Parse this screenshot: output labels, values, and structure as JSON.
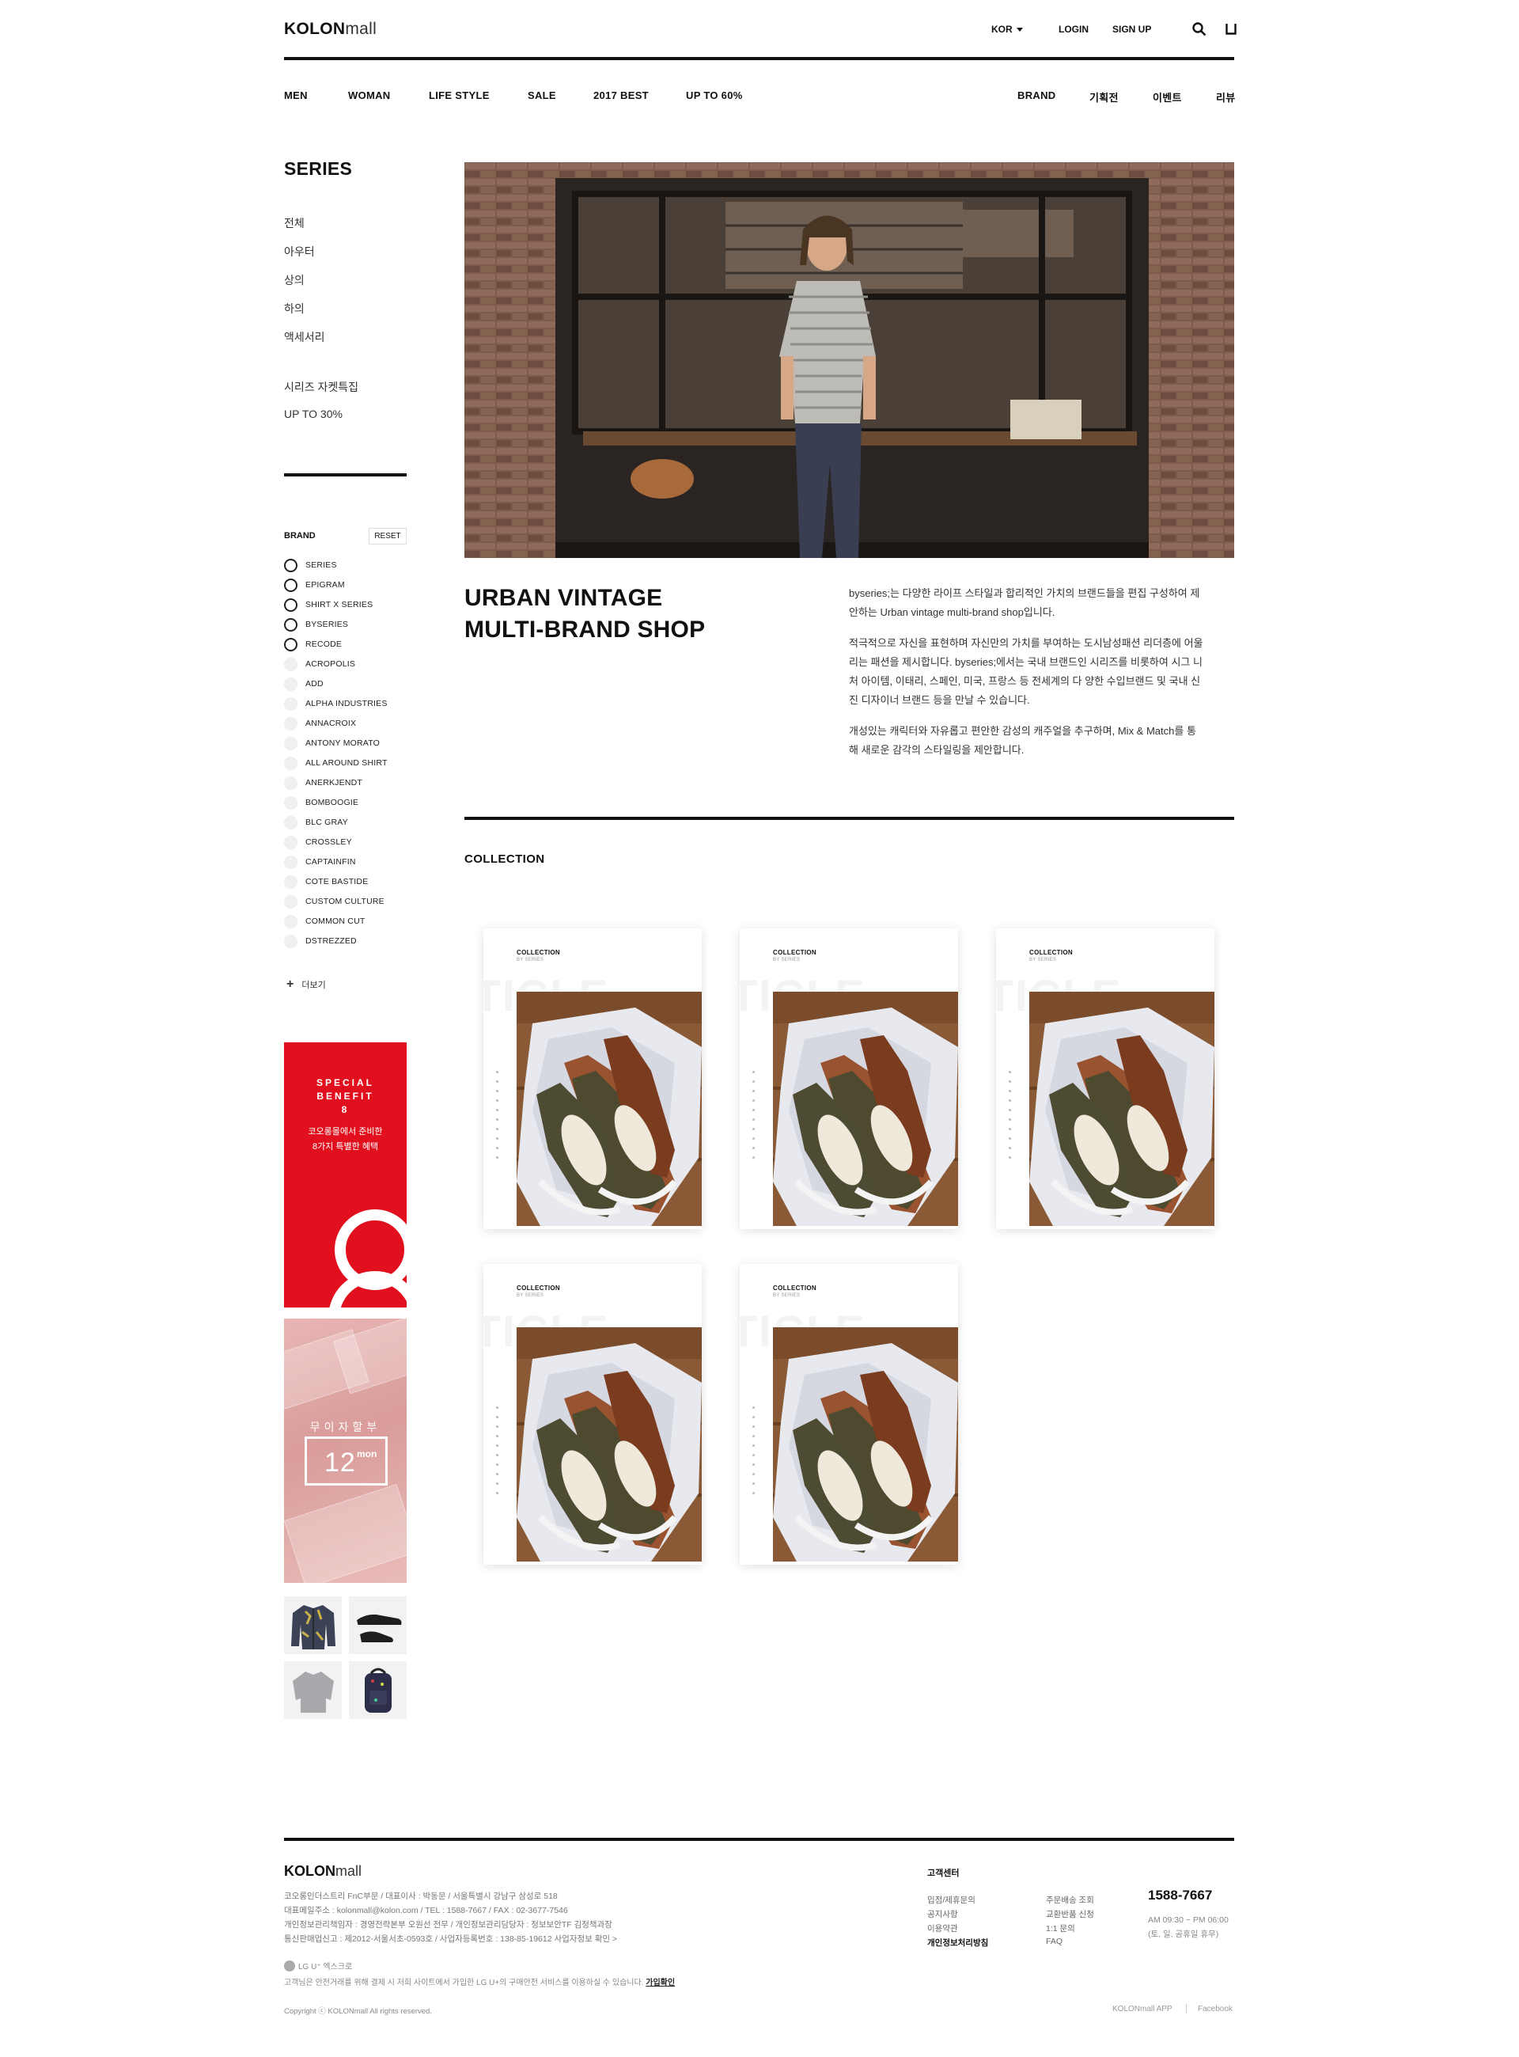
{
  "header": {
    "logo_bold": "KOLON",
    "logo_light": "mall",
    "lang": "KOR",
    "login": "LOGIN",
    "signup": "SIGN UP",
    "icons": [
      "search-icon",
      "bag-icon"
    ]
  },
  "nav": {
    "left": [
      "MEN",
      "WOMAN",
      "LIFE STYLE",
      "SALE",
      "2017 BEST",
      "UP TO 60%"
    ],
    "right": [
      "BRAND",
      "기획전",
      "이벤트",
      "리뷰"
    ]
  },
  "sidebar": {
    "title": "SERIES",
    "categories": [
      "전체",
      "아우터",
      "상의",
      "하의",
      "액세서리"
    ],
    "extras": [
      "시리즈 자켓특집",
      "UP TO 30%"
    ],
    "brand_label": "BRAND",
    "reset": "RESET",
    "brands": [
      "SERIES",
      "EPIGRAM",
      "SHIRT X SERIES",
      "BYSERIES",
      "RECODE",
      "ACROPOLIS",
      "ADD",
      "ALPHA INDUSTRIES",
      "ANNACROIX",
      "ANTONY MORATO",
      "ALL AROUND SHIRT",
      "ANERKJENDT",
      "BOMBOOGIE",
      "BLC GRAY",
      "CROSSLEY",
      "CAPTAINFIN",
      "COTE BASTIDE",
      "CUSTOM CULTURE",
      "COMMON CUT",
      "DSTREZZED"
    ],
    "more": "더보기"
  },
  "banner_red": {
    "line1": "SPECIAL",
    "line2": "BENEFIT",
    "line3": "8",
    "text1": "코오롱몰에서 준비한",
    "text2": "8가지 특별한 혜택"
  },
  "banner_pink": {
    "title": "무이자할부",
    "number": "12",
    "unit": "mon"
  },
  "main": {
    "headline1": "URBAN VINTAGE",
    "headline2": "MULTI-BRAND SHOP",
    "desc": [
      "byseries;는 다양한 라이프 스타일과 합리적인 가치의 브랜드들을 편집 구성하여 제안하는 Urban vintage multi-brand shop입니다.",
      "적극적으로 자신을 표현하며 자신만의 가치를 부여하는 도시남성패션 리더층에 어울리는 패션을 제시합니다. byseries;에서는 국내 브랜드인 시리즈를 비롯하여 시그 니처 아이템, 이태리, 스페인, 미국, 프랑스 등 전세계의 다 양한 수입브랜드 및 국내 신진 디자이너 브랜드 등을 만날 수 있습니다.",
      "개성있는 캐릭터와 자유롭고 편안한 감성의 캐주얼을 추구하며, Mix & Match를 통해 새로운 감각의 스타일링을 제안합니다."
    ],
    "collection_title": "COLLECTION",
    "card_title": "COLLECTION",
    "card_sub": "BY SERIES",
    "card_watermark": "TICLE"
  },
  "footer": {
    "logo_bold": "KOLON",
    "logo_light": "mall",
    "info": [
      "코오롱인더스트리 FnC부문 / 대표이사 : 박동문 / 서울특별시 강남구 삼성로 518",
      "대표메일주소 : kolonmall@kolon.com / TEL : 1588-7667 / FAX : 02-3677-7546",
      "개인정보관리책임자 : 경영전략본부 오원선 전무 / 개인정보관리담당자 : 정보보안TF 김정책과장",
      "통신판매업신고 : 제2012-서울서초-0593호 / 사업자등록번호 : 138-85-19612  사업자정보 확인 >"
    ],
    "lg_label": "LG U⁺ 엑스크로",
    "lg_text": "고객님은 안전거래를 위해 결제 시 저희 사이트에서 가입한 LG U+의 구매안전 서비스를 이용하실 수 있습니다.",
    "lg_link": "가입확인",
    "copyright": "Copyright ⓒ KOLONmall All rights reserved.",
    "cs_title": "고객센터",
    "links_col1": [
      "입점/제휴문의",
      "공지사항",
      "이용약관",
      "개인정보처리방침"
    ],
    "links_col2": [
      "주문배송 조회",
      "교환반품 신청",
      "1:1 문의",
      "FAQ"
    ],
    "phone": "1588-7667",
    "hours1": "AM 09:30 ~ PM 06:00",
    "hours2": "(토, 일, 공휴일 휴무)",
    "app": "KOLONmall APP",
    "facebook": "Facebook"
  }
}
